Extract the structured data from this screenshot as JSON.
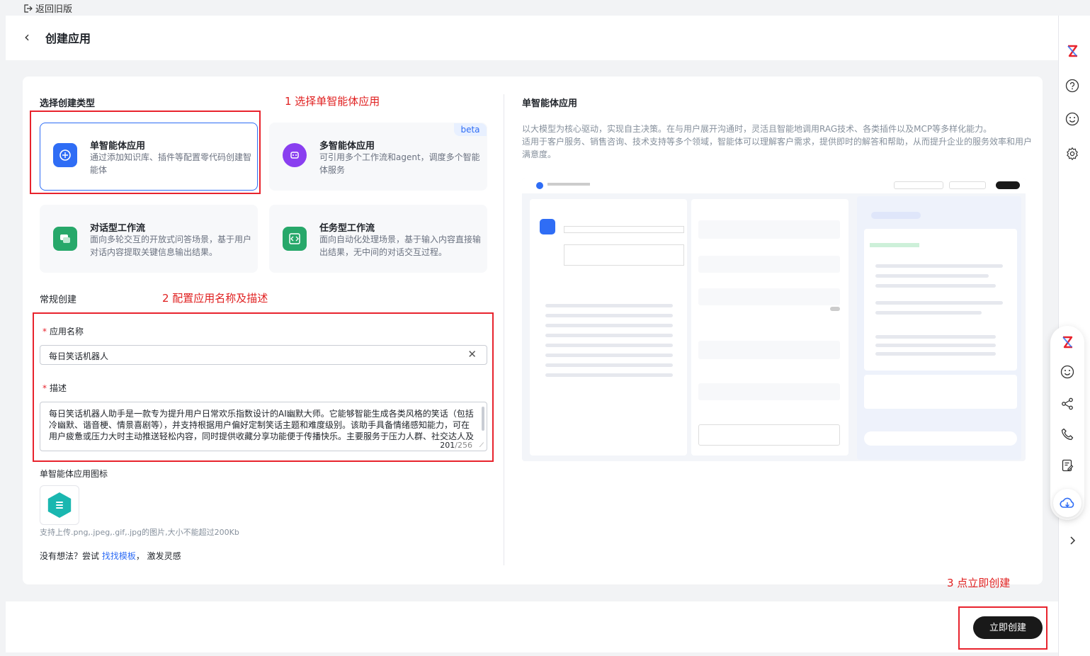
{
  "topbar": {
    "back_old_label": "返回旧版"
  },
  "header": {
    "title": "创建应用"
  },
  "left": {
    "select_type_title": "选择创建类型",
    "annotation_1": "1 选择单智能体应用",
    "types": [
      {
        "name": "单智能体应用",
        "desc": "通过添加知识库、插件等配置零代码创建智能体",
        "icon": "single-agent-icon",
        "color": "#2f6df5",
        "selected": true
      },
      {
        "name": "多智能体应用",
        "desc": "可引用多个工作流和agent，调度多个智能体服务",
        "icon": "multi-agent-icon",
        "color": "#8a3ff0",
        "badge": "beta"
      },
      {
        "name": "对话型工作流",
        "desc": "面向多轮交互的开放式问答场景，基于用户对话内容提取关键信息输出结果。",
        "icon": "chat-workflow-icon",
        "color": "#27a86a"
      },
      {
        "name": "任务型工作流",
        "desc": "面向自动化处理场景，基于输入内容直接输出结果，无中间的对话交互过程。",
        "icon": "task-workflow-icon",
        "color": "#27a86a"
      }
    ],
    "normal_create_title": "常规创建",
    "annotation_2": "2 配置应用名称及描述",
    "app_name_label": "应用名称",
    "app_name_value": "每日笑话机器人",
    "desc_label": "描述",
    "desc_value": "每日笑话机器人助手是一款专为提升用户日常欢乐指数设计的AI幽默大师。它能够智能生成各类风格的笑话（包括冷幽默、谐音梗、情景喜剧等），并支持根据用户偏好定制笑话主题和难度级别。该助手具备情绪感知能力，可在用户疲惫或压力大时主动推送轻松内容，同时提供收藏分享功能便于传播快乐。主要服务于压力人群、社交达人及",
    "desc_count": "201",
    "desc_max": "/256",
    "icon_label": "单智能体应用图标",
    "icon_hint": "支持上传.png,.jpeg,.gif,.jpg的图片,大小不能超过200Kb",
    "idea_prefix": "没有想法？尝试 ",
    "idea_link": "找找模板",
    "idea_suffix": "， 激发灵感"
  },
  "right": {
    "title": "单智能体应用",
    "desc_line1": "以大模型为核心驱动，实现自主决策。在与用户展开沟通时，灵活且智能地调用RAG技术、各类插件以及MCP等多样化能力。",
    "desc_line2": "适用于客户服务、销售咨询、技术支持等多个领域，智能体可以理解客户需求，提供即时的解答和帮助，从而提升企业的服务效率和用户满意度。"
  },
  "footer": {
    "annotation_3": "3 点立即创建",
    "create_label": "立即创建"
  },
  "colors": {
    "accent": "#2f6df5",
    "annotation": "#e8232d",
    "primary_button": "#191919"
  }
}
